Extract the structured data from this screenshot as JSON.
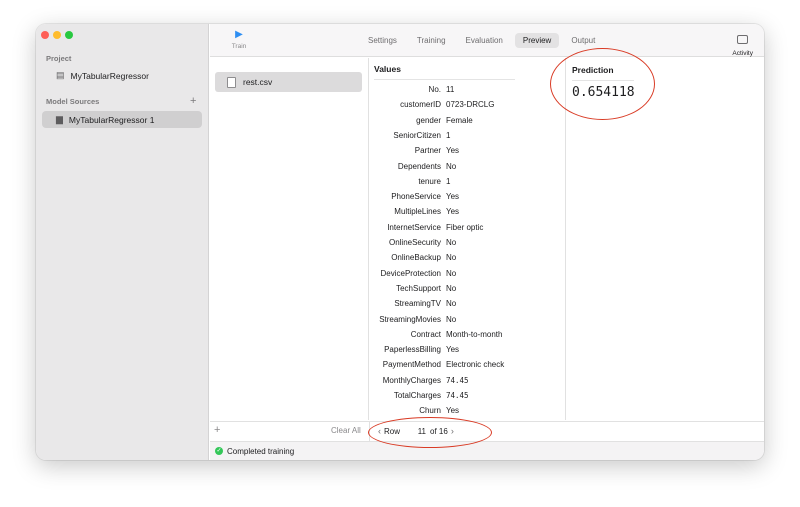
{
  "colors": {
    "accent": "#2e8ef2",
    "annotation": "#d93b25",
    "success": "#34c759"
  },
  "sidebar": {
    "project_header": "Project",
    "project_item": "MyTabularRegressor",
    "sources_header": "Model Sources",
    "add_source_icon": "plus-icon",
    "source_item": "MyTabularRegressor 1"
  },
  "toolbar": {
    "train_icon": "play-icon",
    "train_label": "Train",
    "tabs": [
      {
        "label": "Settings",
        "active": false
      },
      {
        "label": "Training",
        "active": false
      },
      {
        "label": "Evaluation",
        "active": false
      },
      {
        "label": "Preview",
        "active": true
      },
      {
        "label": "Output",
        "active": false
      }
    ],
    "activity_label": "Activity"
  },
  "files": {
    "items": [
      {
        "name": "rest.csv"
      }
    ]
  },
  "values": {
    "title": "Values",
    "rows": [
      {
        "key": "No.",
        "value": "11"
      },
      {
        "key": "customerID",
        "value": "0723-DRCLG"
      },
      {
        "key": "gender",
        "value": "Female"
      },
      {
        "key": "SeniorCitizen",
        "value": "1"
      },
      {
        "key": "Partner",
        "value": "Yes"
      },
      {
        "key": "Dependents",
        "value": "No"
      },
      {
        "key": "tenure",
        "value": "1"
      },
      {
        "key": "PhoneService",
        "value": "Yes"
      },
      {
        "key": "MultipleLines",
        "value": "Yes"
      },
      {
        "key": "InternetService",
        "value": "Fiber optic"
      },
      {
        "key": "OnlineSecurity",
        "value": "No"
      },
      {
        "key": "OnlineBackup",
        "value": "No"
      },
      {
        "key": "DeviceProtection",
        "value": "No"
      },
      {
        "key": "TechSupport",
        "value": "No"
      },
      {
        "key": "StreamingTV",
        "value": "No"
      },
      {
        "key": "StreamingMovies",
        "value": "No"
      },
      {
        "key": "Contract",
        "value": "Month-to-month"
      },
      {
        "key": "PaperlessBilling",
        "value": "Yes"
      },
      {
        "key": "PaymentMethod",
        "value": "Electronic check"
      },
      {
        "key": "MonthlyCharges",
        "value": "74.45"
      },
      {
        "key": "TotalCharges",
        "value": "74.45"
      },
      {
        "key": "Churn",
        "value": "Yes"
      }
    ]
  },
  "prediction": {
    "title": "Prediction",
    "value": "0.654118"
  },
  "bottom": {
    "add_label": "+",
    "clear_all": "Clear All",
    "row_label": "Row",
    "row_value": "11",
    "of_label": "of 16",
    "prev_arrow": "‹",
    "next_arrow": "›"
  },
  "status": {
    "text": "Completed training"
  }
}
